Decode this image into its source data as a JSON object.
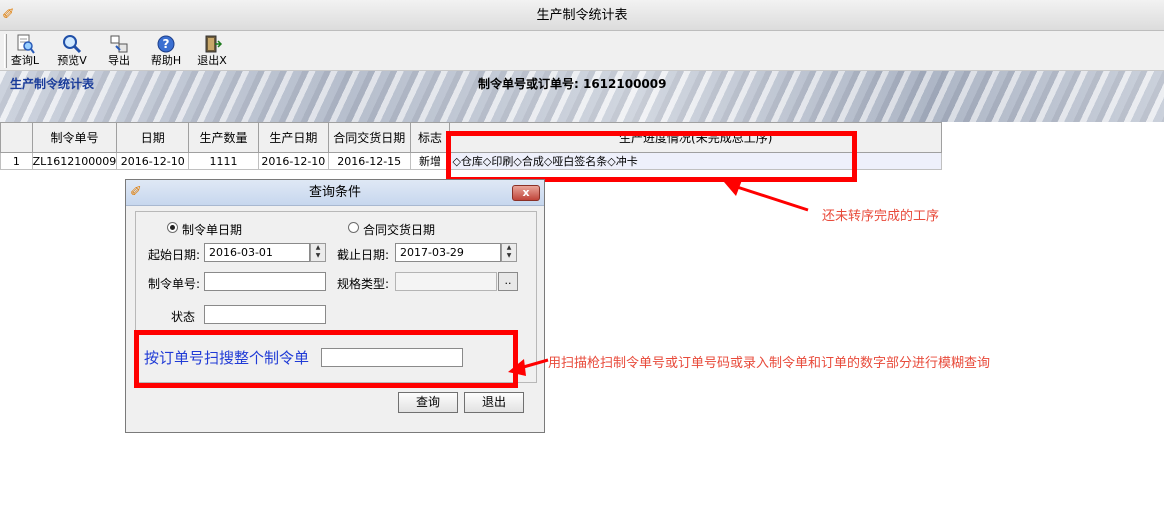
{
  "window": {
    "title": "生产制令统计表"
  },
  "toolbar": {
    "query": "查询L",
    "preview": "预览V",
    "export": "导出",
    "help": "帮助H",
    "exit": "退出X"
  },
  "banner": {
    "left_title": "生产制令统计表",
    "center_title": "制令单号或订单号: 1612100009"
  },
  "table": {
    "headers": [
      "",
      "制令单号",
      "日期",
      "生产数量",
      "生产日期",
      "合同交货日期",
      "标志",
      "生产进度情况(未完成总工序)"
    ],
    "rows": [
      [
        "1",
        "ZL1612100009",
        "2016-12-10",
        "1111",
        "2016-12-10",
        "2016-12-15",
        "新增",
        "◇仓库◇印刷◇合成◇哑白签名条◇冲卡"
      ]
    ]
  },
  "annotations": {
    "unfinished": "还未转序完成的工序",
    "scan_hint": "用扫描枪扫制令单号或订单号码或录入制令单和订单的数字部分进行模糊查询"
  },
  "dialog": {
    "title": "查询条件",
    "close": "x",
    "radio_order_date": "制令单日期",
    "radio_contract_date": "合同交货日期",
    "start_label": "起始日期:",
    "start_value": "2016-03-01",
    "end_label": "截止日期:",
    "end_value": "2017-03-29",
    "order_no_label": "制令单号:",
    "order_no_value": "",
    "spec_label": "规格类型:",
    "spec_value": "",
    "browse": "..",
    "status_label": "状态",
    "status_value": "",
    "scan_label": "按订单号扫搜整个制令单",
    "scan_value": "",
    "query_button": "查询",
    "exit_button": "退出"
  },
  "colors": {
    "annotation_red": "#ff0000",
    "scan_blue": "#1f3ad6",
    "banner_title_blue": "#1a3c9a"
  }
}
